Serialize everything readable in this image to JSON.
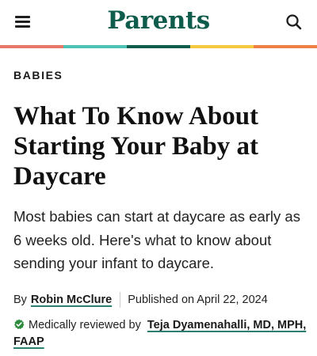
{
  "header": {
    "logo": "Parents",
    "menu_icon": "hamburger-menu-icon",
    "search_icon": "search-icon",
    "stripe_colors": [
      "#e8766a",
      "#4cc3b4",
      "#0f5c4d",
      "#f5c842",
      "#ef8148"
    ]
  },
  "article": {
    "category": "BABIES",
    "headline": "What To Know About Starting Your Baby at Daycare",
    "dek": "Most babies can start at daycare as early as 6 weeks old. Here's what to know about sending your infant to daycare.",
    "byline": {
      "by_label": "By",
      "author": "Robin McClure",
      "published": "Published on April 22, 2024"
    },
    "review": {
      "check_icon": "verified-check-icon",
      "label": "Medically reviewed by",
      "reviewer": "Teja Dyamenahalli, MD, MPH, FAAP"
    }
  },
  "colors": {
    "logo": "#0e5c4c",
    "verified_green": "#2e8b3e",
    "link_underline": "#2a7f6f"
  }
}
